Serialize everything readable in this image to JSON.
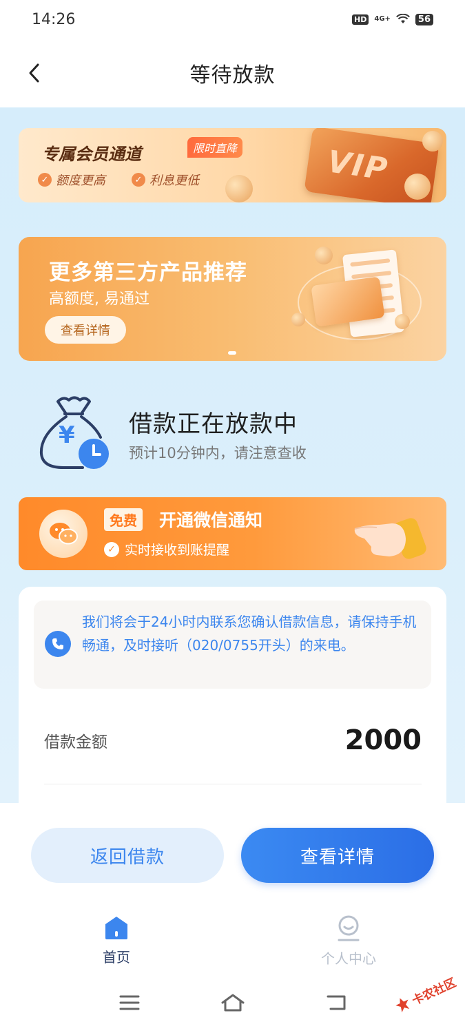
{
  "status_bar": {
    "time": "14:26",
    "hd": "HD",
    "network": "4G+",
    "battery": "56"
  },
  "nav": {
    "title": "等待放款"
  },
  "vip_banner": {
    "title": "专属会员通道",
    "badge": "限时直降",
    "features": [
      "额度更高",
      "利息更低"
    ],
    "card_text": "VIP"
  },
  "promo_banner": {
    "title": "更多第三方产品推荐",
    "subtitle": "高额度, 易通过",
    "button": "查看详情"
  },
  "loan_status": {
    "title": "借款正在放款中",
    "subtitle": "预计10分钟内，请注意查收",
    "currency_symbol": "¥"
  },
  "wechat_banner": {
    "free_tag": "免费",
    "title": "开通微信通知",
    "subtitle": "实时接收到账提醒"
  },
  "info_card": {
    "notice": "我们将会于24小时内联系您确认借款信息，请保持手机畅通，及时接听（020/0755开头）的来电。",
    "amount_label": "借款金额",
    "amount_value": "2000"
  },
  "actions": {
    "return_label": "返回借款",
    "detail_label": "查看详情"
  },
  "tab_bar": {
    "items": [
      {
        "label": "首页",
        "icon": "home-icon",
        "active": true
      },
      {
        "label": "个人中心",
        "icon": "profile-icon",
        "active": false
      }
    ]
  },
  "watermark": {
    "text": "卡农社区"
  },
  "colors": {
    "primary_blue": "#3c86ee",
    "orange": "#ff8a2a",
    "content_bg": "#d6edfb"
  }
}
